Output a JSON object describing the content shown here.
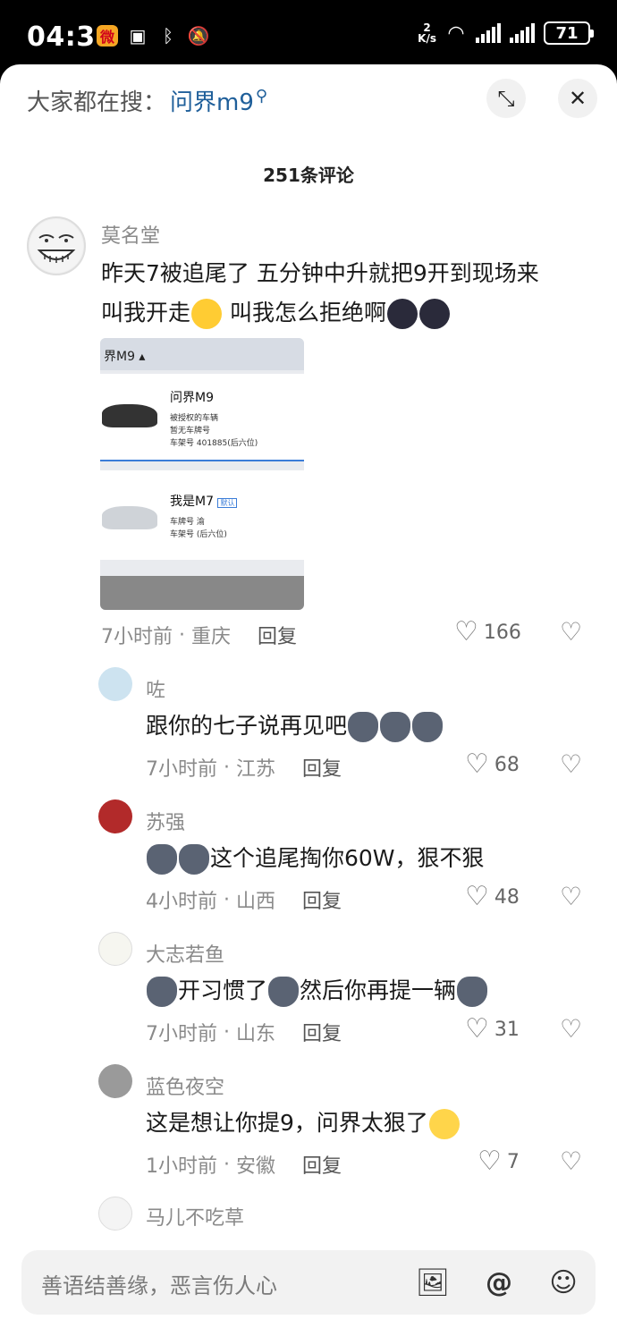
{
  "status_bar": {
    "time": "04:36",
    "speed_top": "2",
    "speed_unit": "K/s",
    "battery": "71"
  },
  "search": {
    "prefix": "大家都在搜：",
    "term": "问界m9"
  },
  "comments_title": "251条评论",
  "comments": [
    {
      "author": "莫名堂",
      "text_line1": "昨天7被追尾了 五分钟中升就把9开到现场来",
      "text_line2": "叫我开走",
      "text_line2b": " 叫我怎么拒绝啊",
      "time": "7小时前",
      "location": "重庆",
      "reply": "回复",
      "likes": "166"
    },
    {
      "author": "咗",
      "text": "跟你的七子说再见吧",
      "time": "7小时前",
      "location": "江苏",
      "reply": "回复",
      "likes": "68"
    },
    {
      "author": "苏强",
      "text": "这个追尾掏你60W，狠不狠",
      "time": "4小时前",
      "location": "山西",
      "reply": "回复",
      "likes": "48"
    },
    {
      "author": "大志若鱼",
      "text_a": "开习惯了",
      "text_b": "然后你再提一辆",
      "time": "7小时前",
      "location": "山东",
      "reply": "回复",
      "likes": "31"
    },
    {
      "author": "蓝色夜空",
      "text": "这是想让你提9，问界太狠了",
      "time": "1小时前",
      "location": "安徽",
      "reply": "回复",
      "likes": "7"
    },
    {
      "author": "马儿不吃草"
    }
  ],
  "image": {
    "topbar": "界M9 ▴",
    "card1_name": "问界M9",
    "card1_line1": "被授权的车辆",
    "card1_line2": "暂无车牌号",
    "card1_line3": "车架号 401885(后六位)",
    "card2_name": "我是M7",
    "card2_badge": "默认",
    "card2_line1": "车牌号 渝",
    "card2_line2": "车架号 (后六位)"
  },
  "input": {
    "placeholder": "善语结善缘，恶言伤人心"
  },
  "icons": {
    "close": "close-icon",
    "collapse": "collapse-icon",
    "heart": "heart-icon",
    "dislike": "broken-heart-icon",
    "image": "image-icon",
    "mention": "at-icon",
    "emoji": "emoji-icon"
  }
}
